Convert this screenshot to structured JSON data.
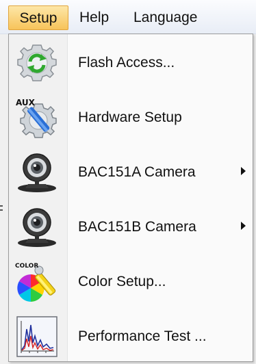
{
  "menubar": {
    "items": [
      {
        "label": "Setup",
        "active": true
      },
      {
        "label": "Help",
        "active": false
      },
      {
        "label": "Language",
        "active": false
      }
    ]
  },
  "dropdown": {
    "items": [
      {
        "label": "Flash Access...",
        "icon": "refresh-gear-icon",
        "submenu": false
      },
      {
        "label": "Hardware Setup",
        "icon": "aux-hardware-icon",
        "submenu": false
      },
      {
        "label": "BAC151A Camera",
        "icon": "webcam-icon",
        "submenu": true
      },
      {
        "label": "BAC151B Camera",
        "icon": "webcam-icon",
        "submenu": true
      },
      {
        "label": "Color Setup...",
        "icon": "color-setup-icon",
        "submenu": false
      },
      {
        "label": "Performance Test ...",
        "icon": "performance-chart-icon",
        "submenu": false
      }
    ]
  },
  "icon_text": {
    "aux": "AUX",
    "color": "COLOR"
  },
  "colors": {
    "menu_highlight": "#f7c35a",
    "menubar_bg": "#eef2f8",
    "dropdown_bg": "#fafafa",
    "gutter_bg": "#f1f1f1"
  }
}
